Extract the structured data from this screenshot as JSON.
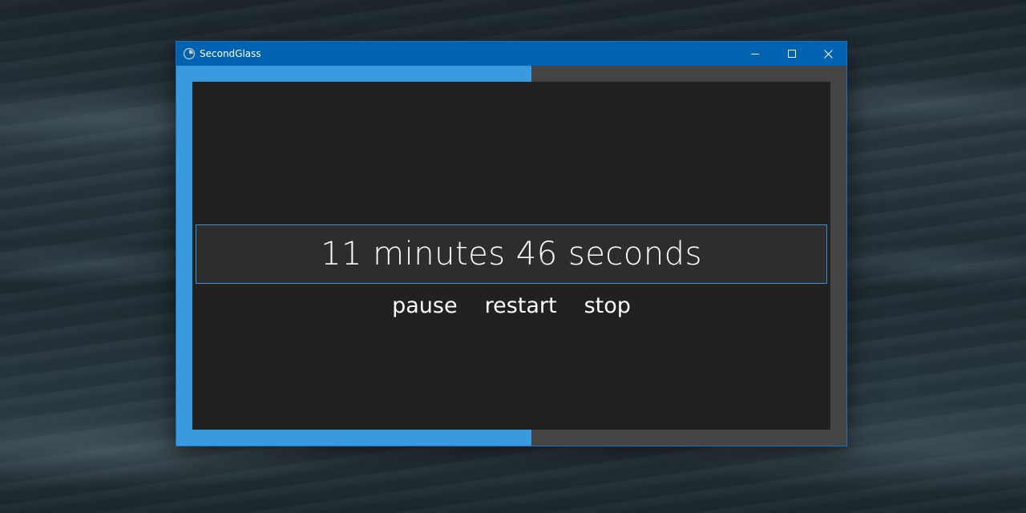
{
  "window": {
    "title": "SecondGlass",
    "icon": "clock-icon",
    "caption_buttons": [
      "minimize-icon",
      "maximize-icon",
      "close-icon"
    ]
  },
  "timer": {
    "display": "11 minutes 46 seconds",
    "progress_fraction": 0.53
  },
  "controls": {
    "pause_label": "pause",
    "restart_label": "restart",
    "stop_label": "stop"
  },
  "colors": {
    "titlebar": "#0063b1",
    "progress": "#3a9ade",
    "track": "#444444",
    "panel": "#212121",
    "time_box": "#2d2d2d",
    "time_box_border": "#3b8fd6",
    "text": "#ffffff"
  }
}
